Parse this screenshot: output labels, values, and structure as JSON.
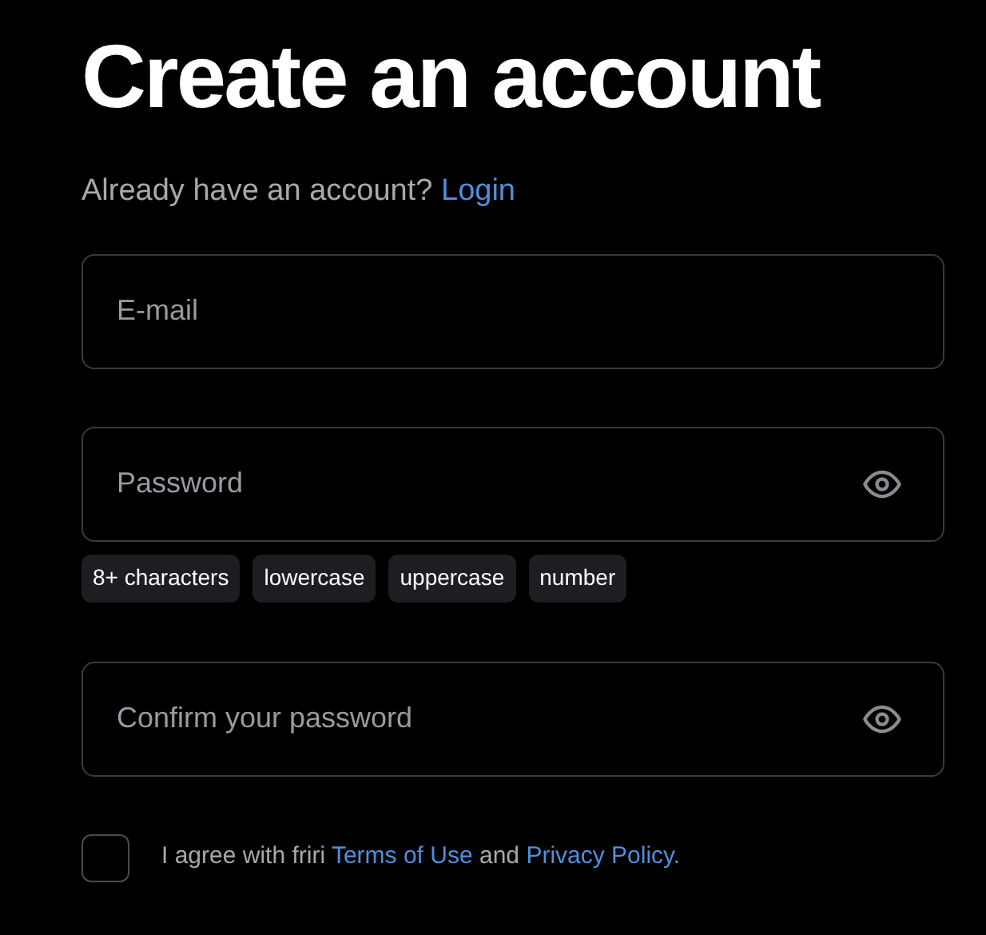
{
  "title": "Create an account",
  "login_prompt": {
    "text": "Already have an account?",
    "link": "Login"
  },
  "fields": [
    {
      "kind": "text",
      "placeholder": "E-mail"
    },
    {
      "kind": "password",
      "placeholder": "Password"
    },
    {
      "kind": "password",
      "placeholder": "Confirm your password"
    }
  ],
  "password_rules": [
    "8+ characters",
    "lowercase",
    "uppercase",
    "number"
  ],
  "agreement": {
    "checked": false,
    "prefix": "I agree with friri",
    "terms_link": "Terms of Use",
    "middle": "and",
    "privacy_link": "Privacy Policy."
  }
}
